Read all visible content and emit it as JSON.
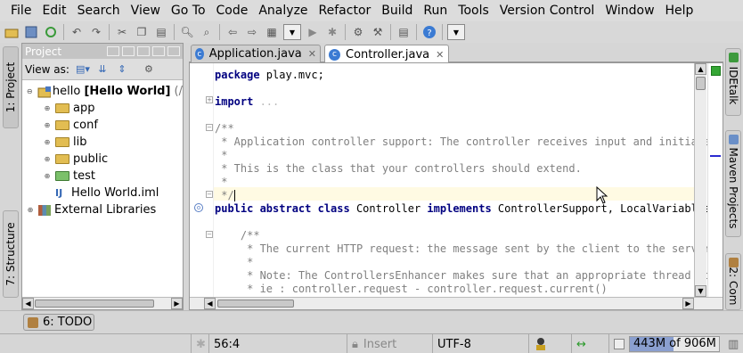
{
  "menu": [
    "File",
    "Edit",
    "Search",
    "View",
    "Go To",
    "Code",
    "Analyze",
    "Refactor",
    "Build",
    "Run",
    "Tools",
    "Version Control",
    "Window",
    "Help"
  ],
  "toolbar": {
    "icons": [
      "open-folder-icon",
      "save-icon",
      "sync-icon",
      "undo-icon",
      "redo-icon",
      "cut-icon",
      "copy-icon",
      "paste-icon",
      "find-icon",
      "replace-icon",
      "back-icon",
      "forward-icon",
      "structure-icon",
      "run-config-combo",
      "run-icon",
      "debug-icon",
      "settings-icon",
      "project-structure-icon",
      "sdk-icon",
      "help-icon",
      "dropdown-combo"
    ]
  },
  "left_strip": {
    "project_tab": "1: Project",
    "structure_tab": "7: Structure"
  },
  "project_panel": {
    "title": "Project",
    "view_as_label": "View as:",
    "tree": [
      {
        "label": "hello",
        "bold": "[Hello World]",
        "suffix": "(/",
        "depth": 0,
        "expanded": true,
        "icon": "module-icon"
      },
      {
        "label": "app",
        "depth": 1,
        "icon": "folder-icon"
      },
      {
        "label": "conf",
        "depth": 1,
        "icon": "folder-icon"
      },
      {
        "label": "lib",
        "depth": 1,
        "icon": "folder-icon"
      },
      {
        "label": "public",
        "depth": 1,
        "icon": "folder-icon"
      },
      {
        "label": "test",
        "depth": 1,
        "icon": "test-folder-icon"
      },
      {
        "label": "Hello World.iml",
        "depth": 1,
        "icon": "iml-file-icon"
      },
      {
        "label": "External Libraries",
        "depth": 0,
        "icon": "libraries-icon"
      }
    ]
  },
  "editor": {
    "tabs": [
      {
        "label": "Application.java",
        "active": false
      },
      {
        "label": "Controller.java",
        "active": true
      }
    ],
    "lines": {
      "l1_kw": "package",
      "l1_rest": " play.mvc;",
      "l2_kw": "import",
      "l2_fold": " ...",
      "c1": "/**",
      "c2": " * Application controller support: The controller receives input and initiate",
      "c3": " *",
      "c4": " * This is the class that your controllers should extend.",
      "c5": " *",
      "c6": " */",
      "decl_kw1": "public abstract class",
      "decl_name": " Controller ",
      "decl_kw2": "implements",
      "decl_rest": " ControllerSupport, LocalVariables",
      "d1": "    /**",
      "d2": "     * The current HTTP request: the message sent by the client to the server",
      "d3": "     *",
      "d4": "     * Note: The ControllersEnhancer makes sure that an appropriate thread lo",
      "d5": "     * ie : controller.request - controller.request.current()"
    }
  },
  "right_strip": {
    "tabs": [
      "IDEtalk",
      "Maven Projects",
      "2: Com"
    ]
  },
  "bottom": {
    "todo": "6: TODO"
  },
  "status": {
    "position": "56:4",
    "mode": "Insert",
    "encoding": "UTF-8",
    "memory_used": 443,
    "memory_total": 906,
    "memory_text": "443M of 906M"
  }
}
